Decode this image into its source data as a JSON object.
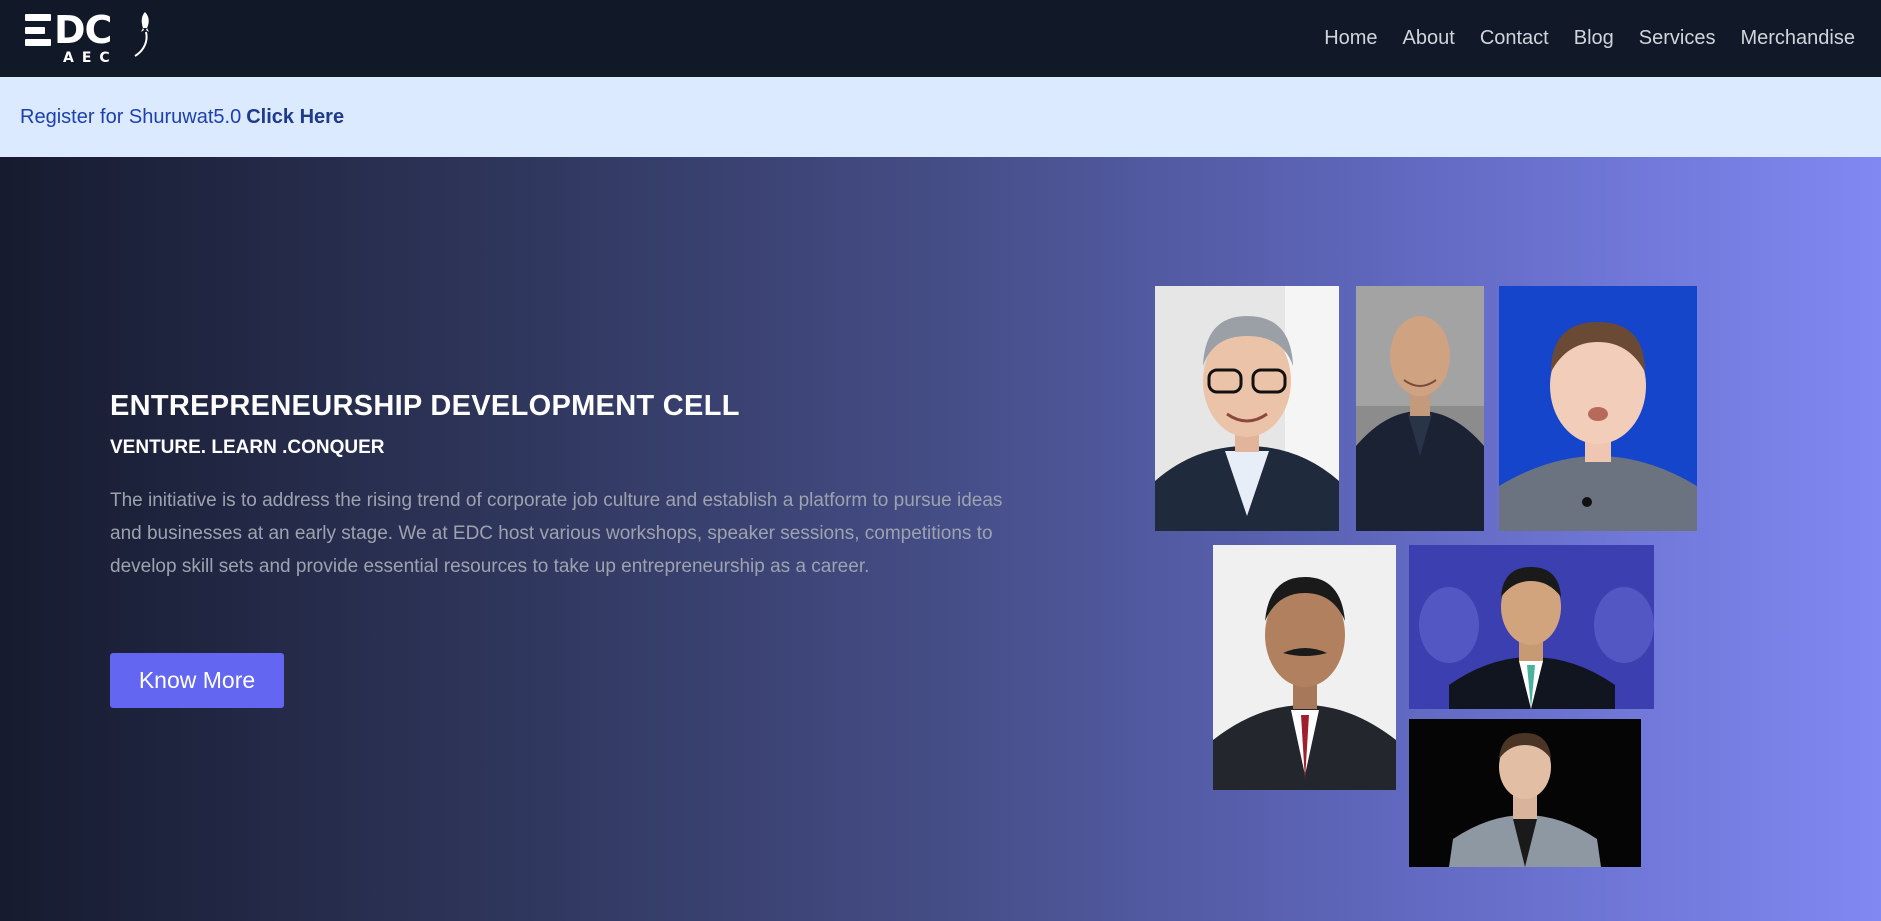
{
  "nav": {
    "logo": {
      "main": "DC",
      "sub": "AEC",
      "icon": "rocket-icon"
    },
    "links": [
      "Home",
      "About",
      "Contact",
      "Blog",
      "Services",
      "Merchandise"
    ]
  },
  "banner": {
    "text": "Register for Shuruwat5.0",
    "link": "Click Here"
  },
  "hero": {
    "title": "ENTREPRENEURSHIP DEVELOPMENT CELL",
    "tagline": "VENTURE. LEARN .CONQUER",
    "description": "The initiative is to address the rising trend of corporate job culture and establish a platform to pursue ideas and businesses at an early stage. We at EDC host various workshops, speaker sessions, competitions to develop skill sets and provide essential resources to take up entrepreneurship as a career.",
    "button": "Know More"
  },
  "colors": {
    "nav_bg": "#111827",
    "banner_bg": "#dbeafe",
    "banner_text": "#1e40af",
    "accent": "#6366f1",
    "gradient_start": "#161b2f",
    "gradient_end": "#8188f2"
  }
}
